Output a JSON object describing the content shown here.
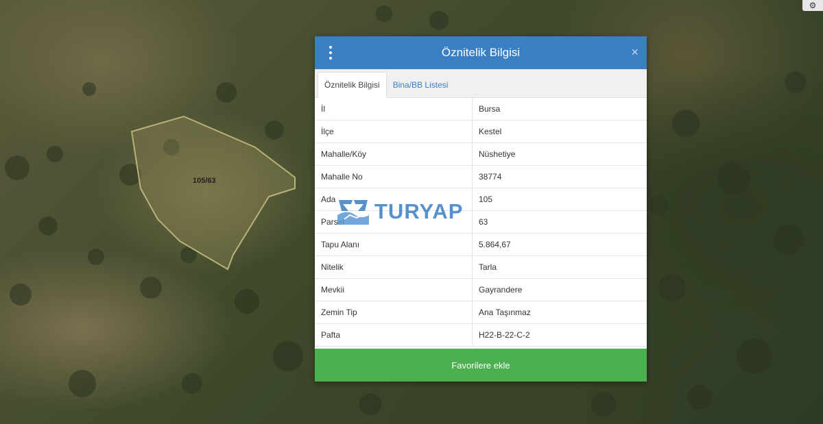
{
  "map": {
    "parcel_label": "105/63",
    "settings_icon": "gear-icon"
  },
  "dialog": {
    "title": "Öznitelik Bilgisi",
    "menu_icon": "kebab-menu-icon",
    "close_label": "×",
    "tabs": [
      {
        "label": "Öznitelik Bilgisi",
        "active": true
      },
      {
        "label": "Bina/BB Listesi",
        "active": false
      }
    ],
    "rows": [
      {
        "key": "İl",
        "value": "Bursa"
      },
      {
        "key": "İlçe",
        "value": "Kestel"
      },
      {
        "key": "Mahalle/Köy",
        "value": "Nüshetiye"
      },
      {
        "key": "Mahalle No",
        "value": "38774"
      },
      {
        "key": "Ada",
        "value": "105"
      },
      {
        "key": "Parsel",
        "value": "63"
      },
      {
        "key": "Tapu Alanı",
        "value": "5.864,67"
      },
      {
        "key": "Nitelik",
        "value": "Tarla"
      },
      {
        "key": "Mevkii",
        "value": "Gayrandere"
      },
      {
        "key": "Zemin Tip",
        "value": "Ana Taşınmaz"
      },
      {
        "key": "Pafta",
        "value": "H22-B-22-C-2"
      }
    ],
    "favorite_button": "Favorilere ekle"
  },
  "watermark": {
    "text": "TURYAP"
  },
  "colors": {
    "header": "#3a7ec3",
    "favorite": "#4cb050",
    "parcel_outline": "#b9b27a"
  }
}
